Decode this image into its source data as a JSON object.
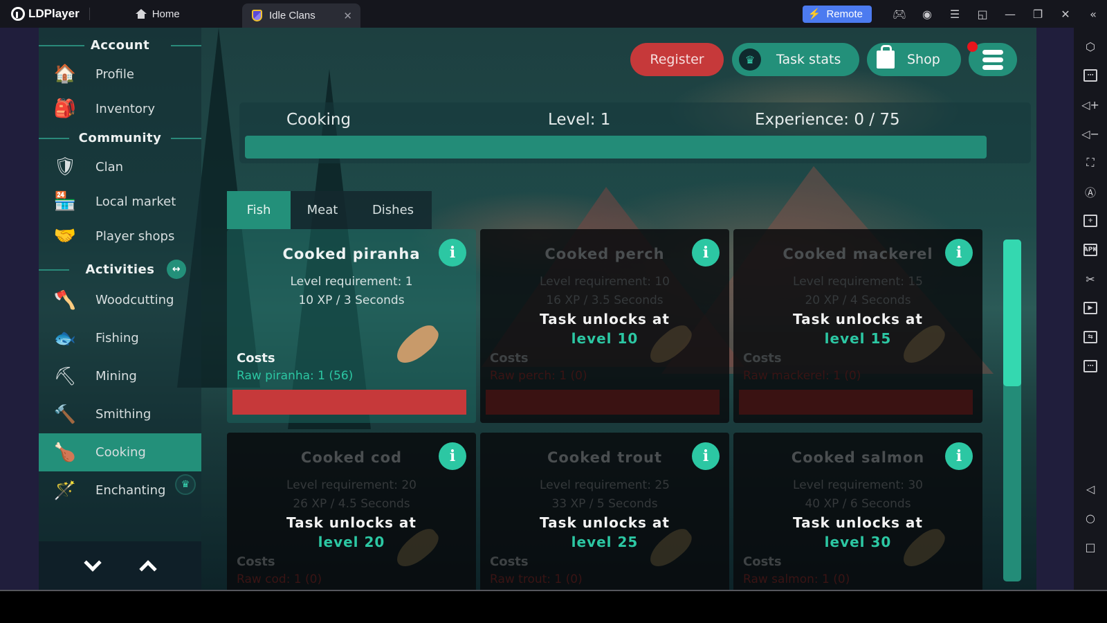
{
  "titlebar": {
    "app_name": "LDPlayer",
    "home_tab": "Home",
    "game_tab": "Idle Clans",
    "remote_label": "Remote",
    "icons": [
      "gamepad-icon",
      "account-icon",
      "menu-icon",
      "resize-icon",
      "minimize-icon",
      "restore-icon",
      "close-icon",
      "collapse-icon"
    ]
  },
  "toolbar": {
    "tools": [
      "settings",
      "keyboard",
      "volume-up",
      "volume-down",
      "fullscreen",
      "auto-rotate",
      "multi-instance",
      "install-apk",
      "screenshot-cut",
      "record-video",
      "sync",
      "more"
    ],
    "android_nav": [
      "back",
      "home",
      "recents"
    ]
  },
  "nav": {
    "sections": [
      {
        "title": "Account",
        "items": [
          {
            "label": "Profile",
            "icon": "house-icon"
          },
          {
            "label": "Inventory",
            "icon": "backpack-icon"
          }
        ]
      },
      {
        "title": "Community",
        "items": [
          {
            "label": "Clan",
            "icon": "shield-icon"
          },
          {
            "label": "Local market",
            "icon": "shop-stall-icon"
          },
          {
            "label": "Player shops",
            "icon": "handshake-icon"
          }
        ]
      },
      {
        "title": "Activities",
        "items": [
          {
            "label": "Woodcutting",
            "icon": "axe-stump-icon"
          },
          {
            "label": "Fishing",
            "icon": "fish-icon"
          },
          {
            "label": "Mining",
            "icon": "pickaxe-icon"
          },
          {
            "label": "Smithing",
            "icon": "hammer-icon"
          },
          {
            "label": "Cooking",
            "icon": "roast-chicken-icon",
            "active": true
          },
          {
            "label": "Enchanting",
            "icon": "magic-wand-icon",
            "premium": true
          }
        ]
      }
    ]
  },
  "top_buttons": {
    "register": "Register",
    "task_stats": "Task stats",
    "shop": "Shop",
    "has_notification": true
  },
  "skill": {
    "name": "Cooking",
    "level_label": "Level: 1",
    "experience_label": "Experience: 0 / 75",
    "xp_progress": 0
  },
  "tabs": [
    {
      "label": "Fish",
      "active": true
    },
    {
      "label": "Meat",
      "active": false
    },
    {
      "label": "Dishes",
      "active": false
    }
  ],
  "cards": [
    {
      "title": "Cooked piranha",
      "requirement": "Level requirement: 1",
      "xp": "10 XP / 3 Seconds",
      "costs_label": "Costs",
      "cost": "Raw piranha: 1 (56)",
      "locked": false
    },
    {
      "title": "Cooked perch",
      "requirement": "Level requirement: 10",
      "xp": "16 XP / 3.5 Seconds",
      "costs_label": "Costs",
      "cost": "Raw perch: 1 (0)",
      "locked": true,
      "lock_text": "Task unlocks at",
      "lock_level": "level 10"
    },
    {
      "title": "Cooked mackerel",
      "requirement": "Level requirement: 15",
      "xp": "20 XP / 4 Seconds",
      "costs_label": "Costs",
      "cost": "Raw mackerel: 1 (0)",
      "locked": true,
      "lock_text": "Task unlocks at",
      "lock_level": "level 15"
    },
    {
      "title": "Cooked cod",
      "requirement": "Level requirement: 20",
      "xp": "26 XP / 4.5 Seconds",
      "costs_label": "Costs",
      "cost": "Raw cod: 1 (0)",
      "locked": true,
      "lock_text": "Task unlocks at",
      "lock_level": "level 20"
    },
    {
      "title": "Cooked trout",
      "requirement": "Level requirement: 25",
      "xp": "33 XP / 5 Seconds",
      "costs_label": "Costs",
      "cost": "Raw trout: 1 (0)",
      "locked": true,
      "lock_text": "Task unlocks at",
      "lock_level": "level 25"
    },
    {
      "title": "Cooked salmon",
      "requirement": "Level requirement: 30",
      "xp": "40 XP / 6 Seconds",
      "costs_label": "Costs",
      "cost": "Raw salmon: 1 (0)",
      "locked": true,
      "lock_text": "Task unlocks at",
      "lock_level": "level 30"
    }
  ],
  "scroll": {
    "position": 0,
    "visible_fraction": 0.43
  },
  "colors": {
    "accent": "#23907a",
    "accent_bright": "#2cc7a3",
    "danger": "#c6393a",
    "remote_blue": "#4c7bf0"
  }
}
